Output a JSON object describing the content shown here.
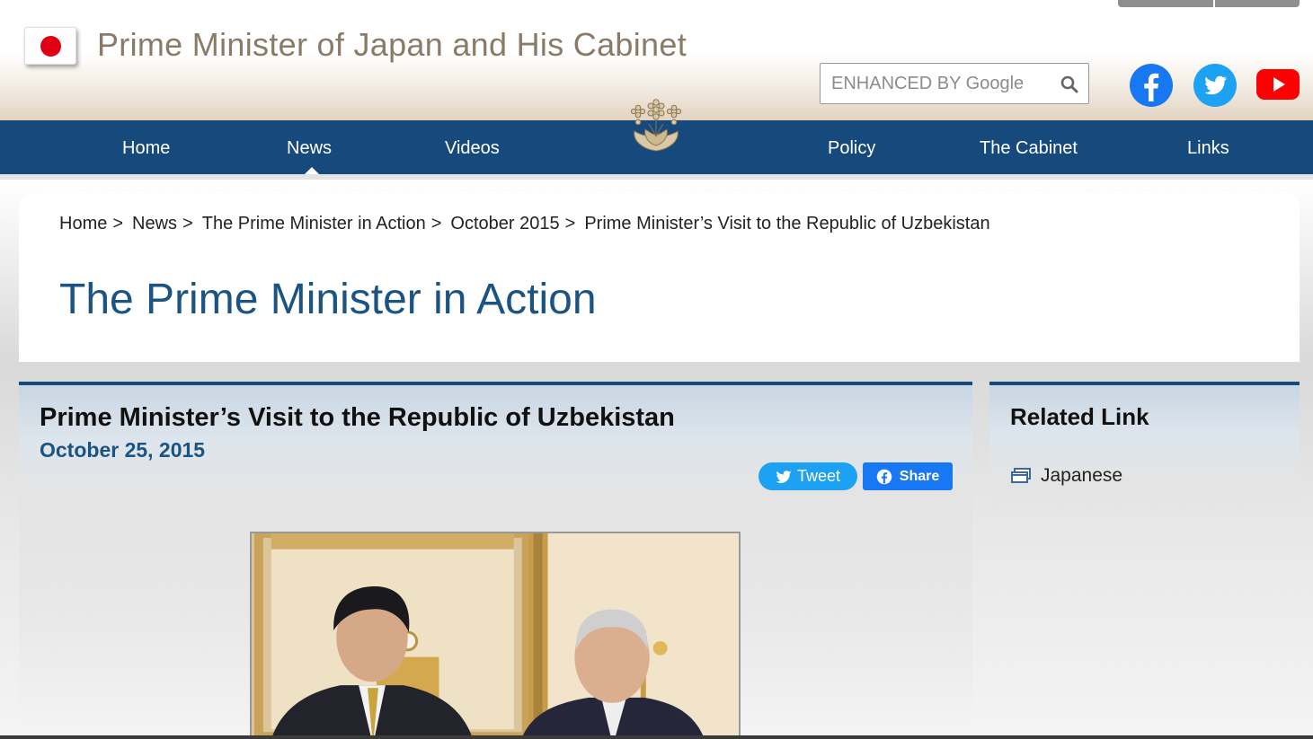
{
  "header": {
    "site_title": "Prime Minister of Japan and His Cabinet",
    "search_placeholder": "ENHANCED BY Google",
    "social": [
      "facebook-icon",
      "twitter-icon",
      "youtube-icon"
    ]
  },
  "nav": {
    "items": [
      "Home",
      "News",
      "Videos",
      "Policy",
      "The Cabinet",
      "Links"
    ],
    "active": "News"
  },
  "breadcrumb": [
    "Home",
    "News",
    "The Prime Minister in Action",
    "October 2015",
    "Prime Minister’s Visit to the Republic of Uzbekistan"
  ],
  "breadcrumb_separator": ">",
  "page_title": "The Prime Minister in Action",
  "article": {
    "title": "Prime Minister’s Visit to the Republic of Uzbekistan",
    "date": "October 25, 2015",
    "tweet_label": "Tweet",
    "share_label": "Share"
  },
  "sidebar": {
    "title": "Related Link",
    "link_label": "Japanese"
  },
  "colors": {
    "nav_bg": "#174a7c",
    "title_blue": "#1b5383",
    "twitter": "#1da1f2",
    "facebook": "#1877f2",
    "youtube": "#ff0000",
    "flag_red": "#e00014"
  }
}
